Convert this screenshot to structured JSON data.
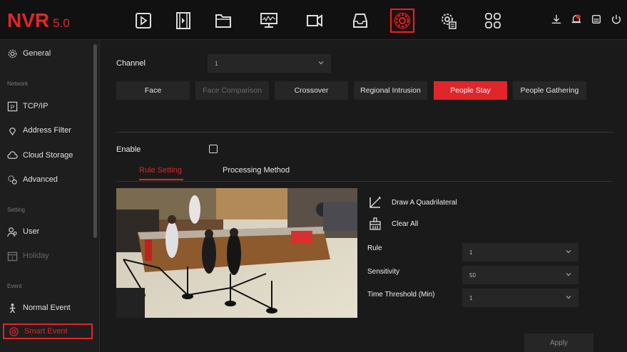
{
  "app": {
    "logo": "NVR",
    "version": "5.0"
  },
  "topnav": {
    "icons": [
      "playback-icon",
      "video-clip-icon",
      "folder-icon",
      "monitor-icon",
      "camera-icon",
      "storage-icon",
      "settings-icon",
      "system-config-icon",
      "grid-icon"
    ],
    "active": "settings-icon",
    "right_icons": [
      "download-icon",
      "alarm-bell-icon",
      "device-icon",
      "power-icon"
    ]
  },
  "sidebar": {
    "general": "General",
    "network_header": "Network",
    "tcpip": "TCP/IP",
    "address_filter": "Address Filter",
    "cloud_storage": "Cloud Storage",
    "advanced": "Advanced",
    "setting_header": "Setting",
    "user": "User",
    "holiday": "Holiday",
    "event_header": "Event",
    "normal_event": "Normal Event",
    "smart_event": "Smart Event"
  },
  "main": {
    "channel_label": "Channel",
    "channel_value": "1",
    "tabs": [
      {
        "label": "Face",
        "state": "normal"
      },
      {
        "label": "Face Comparison",
        "state": "disabled"
      },
      {
        "label": "Crossover",
        "state": "normal"
      },
      {
        "label": "Regional Intrusion",
        "state": "normal"
      },
      {
        "label": "People Stay",
        "state": "active"
      },
      {
        "label": "People Gathering",
        "state": "normal"
      }
    ],
    "enable_label": "Enable",
    "enable_checked": false,
    "subtabs": {
      "rule_setting": "Rule Setting",
      "processing_method": "Processing Method"
    },
    "draw_quad": "Draw A Quadrilateral",
    "clear_all": "Clear All",
    "rule_label": "Rule",
    "rule_value": "1",
    "sensitivity_label": "Sensitivity",
    "sensitivity_value": "50",
    "time_threshold_label": "Time Threshold (Min)",
    "time_threshold_value": "1",
    "apply": "Apply"
  },
  "colors": {
    "accent": "#e0262a",
    "background": "#1a1a1a",
    "panel": "#262626"
  }
}
